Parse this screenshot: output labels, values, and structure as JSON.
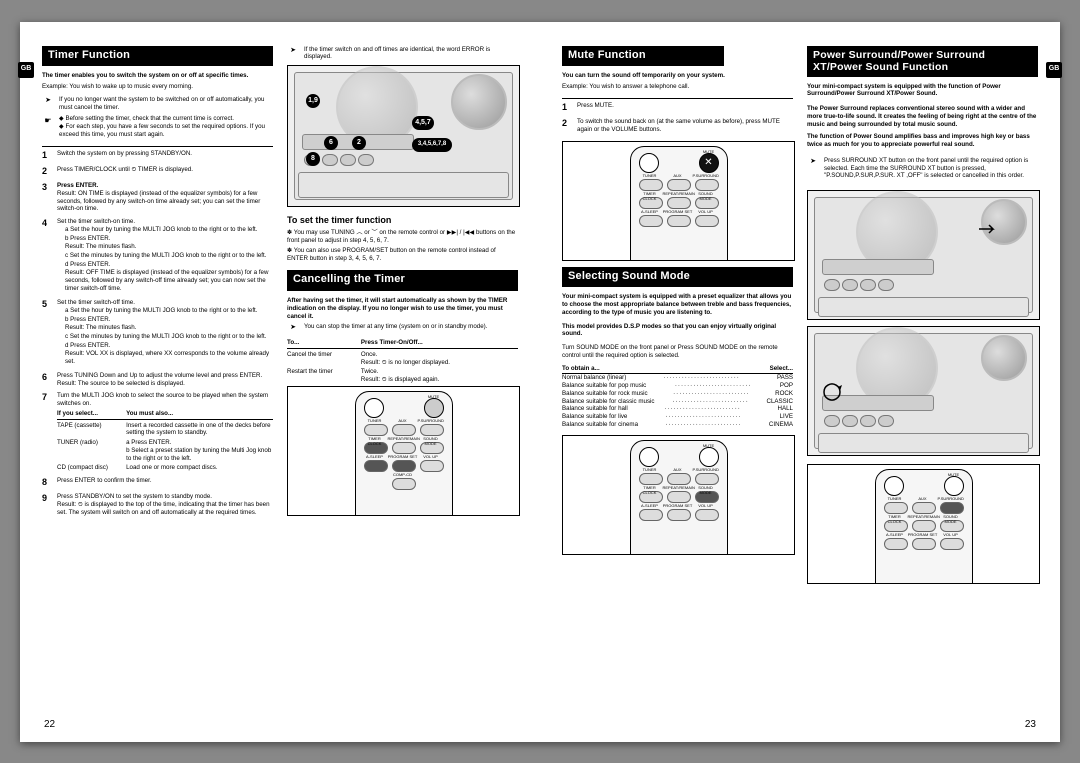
{
  "left": {
    "pagenum": "22",
    "gb": "GB",
    "h1": "Timer Function",
    "intro": "The timer enables you to switch the system on or off at specific times.",
    "example": "Example: You wish to wake up to music every morning.",
    "note1": "If you no longer want the system to be switched on or off automatically, you must cancel the timer.",
    "note2a": "Before setting the timer, check that the current time is correct.",
    "note2b": "For each step, you have a few seconds to set the required options. If you exceed this time, you must start again.",
    "step1": "Switch the system on by pressing STANDBY/ON.",
    "step2": "Press TIMER/CLOCK until ⏲ TIMER is displayed.",
    "step3": "Press ENTER.",
    "step3r": "Result: ON TIME is displayed (instead of the equalizer symbols) for a few seconds, followed by any switch-on time already set; you can set the timer switch-on time.",
    "step4": "Set the timer switch-on time.",
    "step4a": "a  Set the hour by tuning the MULTI JOG knob to the right or to the left.",
    "step4b": "b  Press ENTER.",
    "step4br": "Result: The minutes flash.",
    "step4c": "c  Set the minutes by tuning the MULTI JOG knob to the right or to the left.",
    "step4d": "d  Press ENTER.",
    "step4dr": "Result: OFF TIME is displayed (instead of the equalizer symbols) for a few seconds, followed by any switch-off time already set; you can now set the timer switch-off time.",
    "step5": "Set the timer switch-off time.",
    "step5a": "a  Set the hour by tuning the MULTI JOG knob to the right or to the left.",
    "step5b": "b  Press ENTER.",
    "step5br": "Result: The minutes flash.",
    "step5c": "c  Set the minutes by tuning the MULTI JOG knob to the right or to the left.",
    "step5d": "d  Press ENTER.",
    "step5dr": "Result: VOL XX is displayed, where XX corresponds to the volume already set.",
    "step6": "Press TUNING Down and Up to adjust the volume level and press ENTER.",
    "step6r": "Result: The source to be selected is displayed.",
    "step7": "Turn the MULTI JOG knob to select the source to be played when the system switches on.",
    "thead1": "If you select...",
    "thead2": "You must also...",
    "t1a": "TAPE (cassette)",
    "t1b": "Insert a recorded cassette in one of the decks before setting the system to standby.",
    "t2a": "TUNER (radio)",
    "t2b1": "a  Press ENTER.",
    "t2b2": "b  Select a preset station by tuning the Multi Jog knob to the right or to the left.",
    "t3a": "CD (compact disc)",
    "t3b": "Load one or more compact discs.",
    "step8": "Press ENTER to confirm the timer.",
    "step9": "Press STANDBY/ON to set the system to standby mode.",
    "step9r": "Result: ⏲ is displayed to the top of the time, indicating that the timer has been set. The system will switch on and off automatically at the required times.",
    "rnote": "If the timer switch on and off times are identical, the word ERROR is displayed.",
    "c1": "1,9",
    "c2": "8",
    "c3": "6",
    "c4": "2",
    "c5": "4,5,7",
    "c6": "3,4,5,6,7,8",
    "subhead": "To set the timer function",
    "tip1": "You may use TUNING ︿ or ﹀ on the remote control or ▶▶| / |◀◀ buttons on the front panel to adjust in step 4, 5, 6, 7.",
    "tip2": "You can also use PROGRAM/SET button on the remote control instead of ENTER button in step 3, 4, 5, 6, 7.",
    "h2": "Cancelling the Timer",
    "cancel_intro": "After having set the timer, it will start automatically as shown by the TIMER indication on the display. If you no longer wish to use the timer, you must cancel it.",
    "cancel_note": "You can stop the timer at any time (system on or in standby mode).",
    "cthead1": "To...",
    "cthead2": "Press Timer-On/Off...",
    "c_r1a": "Cancel the timer",
    "c_r1b": "Once.",
    "c_r1r": "Result: ⏲ is no longer displayed.",
    "c_r2a": "Restart the timer",
    "c_r2b": "Twice.",
    "c_r2r": "Result: ⏲ is displayed again.",
    "rlbl_mute": "MUTE",
    "rlbl_tuner": "TUNER",
    "rlbl_aux": "AUX",
    "rlbl_psur": "P.SURROUND",
    "rlbl_tc": "TIMER CLOCK",
    "rlbl_rep": "REPEAT/REMAIN",
    "rlbl_sm": "SOUND MODE",
    "rlbl_as": "A-SLEEP",
    "rlbl_ps": "PROGRAM SET",
    "rlbl_vu": "VOL UP",
    "rlbl_cd": "COMP-CD"
  },
  "right": {
    "pagenum": "23",
    "gb": "GB",
    "h1": "Mute Function",
    "mute_intro": "You can turn the sound off temporarily on your system.",
    "mute_ex": "Example: You wish to answer a telephone call.",
    "m1": "Press MUTE.",
    "m2": "To switch the sound back on (at the same volume as before), press MUTE again or the VOLUME buttons.",
    "h2": "Selecting Sound Mode",
    "sm_intro": "Your mini-compact system is equipped with a preset equalizer that allows you to choose the most appropriate balance between treble and bass frequencies, according to the type of music you are listening to.",
    "sm_model": "This model provides D.S.P modes so that you can enjoy virtually original sound.",
    "sm_turn": "Turn SOUND MODE on the front panel or Press SOUND MODE on the remote control until the required option is selected.",
    "sm_head1": "To obtain a...",
    "sm_head2": "Select...",
    "sm_r1a": "Normal balance (linear)",
    "sm_r1b": "PASS",
    "sm_r2a": "Balance suitable for pop music",
    "sm_r2b": "POP",
    "sm_r3a": "Balance suitable for rock music",
    "sm_r3b": "ROCK",
    "sm_r4a": "Balance suitable for classic music",
    "sm_r4b": "CLASSIC",
    "sm_r5a": "Balance suitable for hall",
    "sm_r5b": "HALL",
    "sm_r6a": "Balance suitable for live",
    "sm_r6b": "LIVE",
    "sm_r7a": "Balance suitable for cinema",
    "sm_r7b": "CINEMA",
    "h3a": "Power Surround/Power Surround",
    "h3b": "XT/Power Sound Function",
    "ps_intro": "Your mini-compact system is equipped with the function of Power Surround/Power Surround XT/Power Sound.",
    "ps_p1": "The Power Surround replaces conventional stereo sound with a wider and more true-to-life sound. It creates the feeling of being right at the centre of the music and being surrounded by total music sound.",
    "ps_p2": "The function of Power Sound amplifies bass and improves high key or bass twice as much for you to appreciate powerful real sound.",
    "ps_note": "Press SURROUND XT button on the front panel until the required option is selected. Each time the SURROUND XT button is pressed, \"P.SOUND,P.SUR,P.SUR. XT ,OFF\" is selected or cancelled in this order.",
    "rlbl_mute": "MUTE",
    "rlbl_tuner": "TUNER",
    "rlbl_aux": "AUX",
    "rlbl_psur": "P.SURROUND",
    "rlbl_tc": "TIMER CLOCK",
    "rlbl_rep": "REPEAT/REMAIN",
    "rlbl_sm": "SOUND MODE",
    "rlbl_as": "A-SLEEP",
    "rlbl_ps": "PROGRAM SET",
    "rlbl_vu": "VOL UP"
  }
}
